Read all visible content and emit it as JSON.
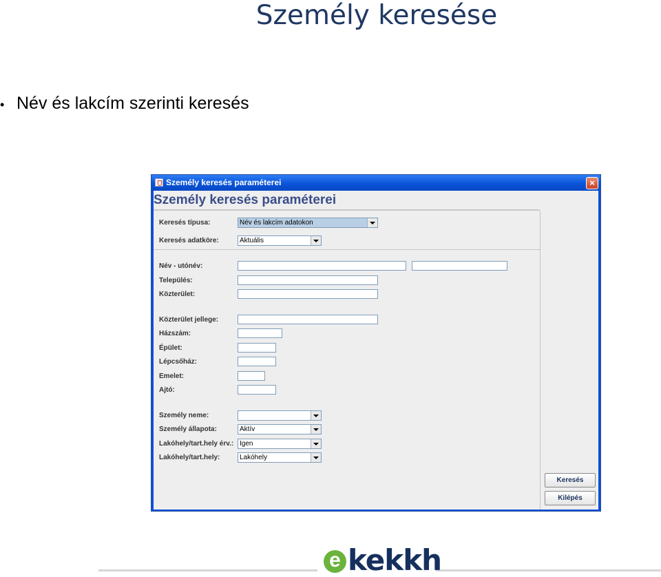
{
  "slide": {
    "title": "Személy keresése",
    "bullet": "Név és lakcím szerinti keresés"
  },
  "window": {
    "title": "Személy keresés paraméterei",
    "header": "Személy keresés paraméterei",
    "close_label": "×"
  },
  "form": {
    "search_type_label": "Keresés típusa:",
    "search_type_value": "Név és lakcím adatokon",
    "search_scope_label": "Keresés adatköre:",
    "search_scope_value": "Aktuális",
    "name_label": "Név - utónév:",
    "settlement_label": "Település:",
    "street_label": "Közterület:",
    "street_type_label": "Közterület jellege:",
    "house_number_label": "Házszám:",
    "building_label": "Épület:",
    "staircase_label": "Lépcsőház:",
    "floor_label": "Emelet:",
    "door_label": "Ajtó:",
    "gender_label": "Személy neme:",
    "gender_value": "",
    "status_label": "Személy állapota:",
    "status_value": "Aktív",
    "residence_valid_label": "Lakóhely/tart.hely érv.:",
    "residence_valid_value": "Igen",
    "residence_label": "Lakóhely/tart.hely:",
    "residence_value": "Lakóhely"
  },
  "buttons": {
    "search": "Keresés",
    "exit": "Kilépés"
  },
  "footer": {
    "logo_mark": "e",
    "logo_text": "kekkh"
  },
  "colors": {
    "title_blue": "#1f3864",
    "window_blue": "#0a54d8",
    "logo_green": "#6ab33c",
    "logo_navy": "#16305e"
  }
}
